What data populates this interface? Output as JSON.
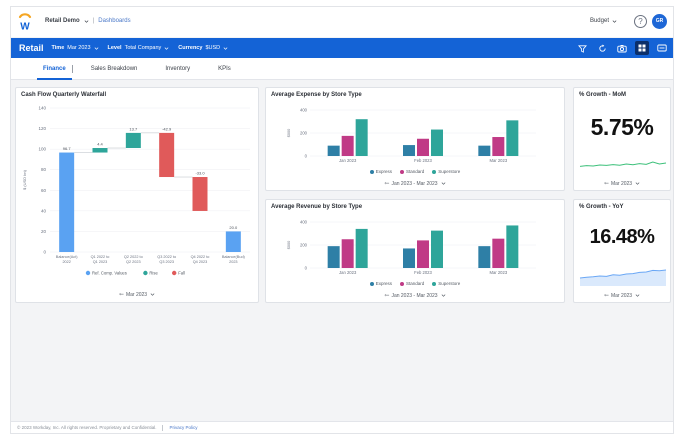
{
  "app": {
    "company": "Retail Demo",
    "crumb": "Dashboards",
    "budget_label": "Budget",
    "help_icon": "?",
    "avatar_initials": "GR"
  },
  "filterbar": {
    "title": "Retail",
    "filters": [
      {
        "label": "Time",
        "value": "Mar 2023"
      },
      {
        "label": "Level",
        "value": "Total Company"
      },
      {
        "label": "Currency",
        "value": "$USD"
      }
    ],
    "icons": [
      "filter-icon",
      "refresh-icon",
      "camera-icon",
      "grid-icon",
      "more-icon"
    ]
  },
  "tabs": [
    {
      "label": "Finance",
      "active": true
    },
    {
      "label": "Sales Breakdown",
      "active": false
    },
    {
      "label": "Inventory",
      "active": false
    },
    {
      "label": "KPIs",
      "active": false
    }
  ],
  "colors": {
    "brand_blue": "#1463d6",
    "express": "#2e7fa6",
    "standard": "#c03a86",
    "superstore": "#2ea59a",
    "waterfall_ref": "#5aa2f2",
    "waterfall_rise": "#2ea59a",
    "waterfall_fall": "#e05a5a",
    "sparkline": "#3cc07a",
    "sparkline_yoy": "#6aa7f5"
  },
  "waterfall": {
    "title": "Cash Flow Quarterly Waterfall",
    "period": "Mar 2023",
    "legend": [
      "Ref. Comp. Values",
      "Rise",
      "Fall"
    ]
  },
  "expense": {
    "title": "Average Expense by Store Type",
    "period": "Jan 2023 - Mar 2023",
    "legend": [
      "Express",
      "Standard",
      "Superstore"
    ]
  },
  "revenue": {
    "title": "Average Revenue by Store Type",
    "period": "Jan 2023 - Mar 2023",
    "legend": [
      "Express",
      "Standard",
      "Superstore"
    ]
  },
  "kpi_mom": {
    "title": "% Growth - MoM",
    "value": "5.75%",
    "period": "Mar 2023",
    "spark": [
      0.38,
      0.42,
      0.4,
      0.45,
      0.43,
      0.47,
      0.44,
      0.5,
      0.46,
      0.52,
      0.48,
      0.6,
      0.5,
      0.55
    ]
  },
  "kpi_yoy": {
    "title": "% Growth - YoY",
    "value": "16.48%",
    "period": "Mar 2023",
    "spark": [
      0.3,
      0.34,
      0.36,
      0.4,
      0.38,
      0.46,
      0.44,
      0.5,
      0.52,
      0.58,
      0.6,
      0.68,
      0.66,
      0.7
    ]
  },
  "footer": {
    "copyright": "© 2023 Workday, Inc. All rights reserved. Proprietary and Confidential.",
    "privacy": "Privacy Policy"
  },
  "chart_data": [
    {
      "type": "bar",
      "subtype": "waterfall",
      "title": "Cash Flow Quarterly Waterfall",
      "ylabel": "$ (USD bn)",
      "ylim": [
        0,
        140
      ],
      "yticks": [
        0,
        20,
        40,
        60,
        80,
        100,
        120,
        140
      ],
      "categories": [
        "Balance(Act) 2022",
        "Q1 2022 to Q1 2023",
        "Q2 2022 to Q2 2023",
        "Q3 2022 to Q3 2023",
        "Q4 2022 to Q4 2023",
        "Balance(Bud) 2023"
      ],
      "bars": [
        {
          "kind": "ref",
          "start": 0,
          "end": 96.7,
          "label": "96.7"
        },
        {
          "kind": "rise",
          "start": 96.7,
          "end": 101.1,
          "label": "4.4"
        },
        {
          "kind": "rise",
          "start": 101.1,
          "end": 115.8,
          "label": "13.7"
        },
        {
          "kind": "fall",
          "start": 115.8,
          "end": 72.9,
          "label": "-42.9"
        },
        {
          "kind": "fall",
          "start": 72.9,
          "end": 39.9,
          "label": "-33.0"
        },
        {
          "kind": "ref",
          "start": 0,
          "end": 20,
          "label": "20.0"
        }
      ],
      "legend": [
        "Ref. Comp. Values",
        "Rise",
        "Fall"
      ]
    },
    {
      "type": "bar",
      "title": "Average Expense by Store Type",
      "ylabel": "$000",
      "ylim": [
        0,
        400
      ],
      "yticks": [
        0,
        200,
        400
      ],
      "categories": [
        "Jan 2023",
        "Feb 2023",
        "Mar 2023"
      ],
      "series": [
        {
          "name": "Express",
          "values": [
            90,
            95,
            90
          ]
        },
        {
          "name": "Standard",
          "values": [
            175,
            150,
            165
          ]
        },
        {
          "name": "Superstore",
          "values": [
            320,
            230,
            310
          ]
        }
      ]
    },
    {
      "type": "bar",
      "title": "Average Revenue by Store Type",
      "ylabel": "$000",
      "ylim": [
        0,
        400
      ],
      "yticks": [
        0,
        200,
        400
      ],
      "categories": [
        "Jan 2023",
        "Feb 2023",
        "Mar 2023"
      ],
      "series": [
        {
          "name": "Express",
          "values": [
            190,
            170,
            190
          ]
        },
        {
          "name": "Standard",
          "values": [
            250,
            240,
            255
          ]
        },
        {
          "name": "Superstore",
          "values": [
            340,
            325,
            370
          ]
        }
      ]
    }
  ]
}
